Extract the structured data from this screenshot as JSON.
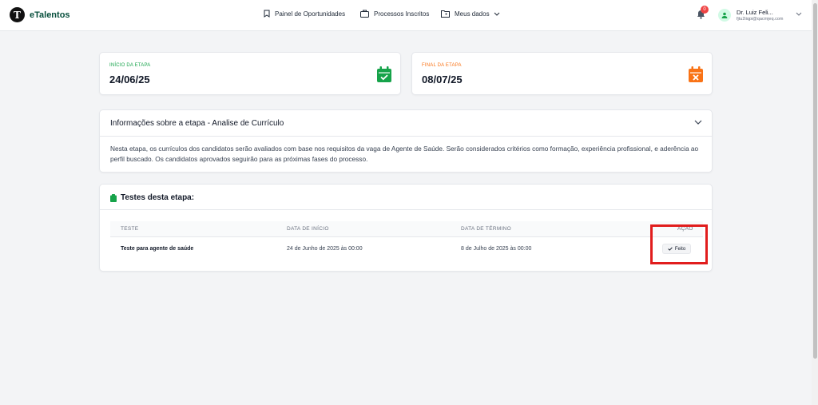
{
  "app": {
    "name": "eTalentos",
    "logo_letter": "T"
  },
  "nav": {
    "opportunities": "Painel de Oportunidades",
    "processes": "Processos Inscritos",
    "my_data": "Meus dados"
  },
  "notifications": {
    "count": "0"
  },
  "user": {
    "name": "Dr. Luiz Feli...",
    "email": "fjtu2iiqpi@qacmjeq.com"
  },
  "stage_start": {
    "label": "INÍCIO DA ETAPA",
    "date": "24/06/25"
  },
  "stage_end": {
    "label": "FINAL DA ETAPA",
    "date": "08/07/25"
  },
  "info": {
    "title": "Informações sobre a etapa - Analise de Currículo",
    "text": "Nesta etapa, os currículos dos candidatos serão avaliados com base nos requisitos da vaga de Agente de Saúde. Serão considerados critérios como formação, experiência profissional, e aderência ao perfil buscado. Os candidatos aprovados seguirão para as próximas fases do processo."
  },
  "tests": {
    "title": "Testes desta etapa:",
    "columns": [
      "TESTE",
      "DATA DE INÍCIO",
      "DATA DE TÉRMINO",
      "AÇÃO"
    ],
    "rows": [
      {
        "name": "Teste para agente de saúde",
        "start": "24 de Junho de 2025 às 00:00",
        "end": "8 de Julho de 2025 às 00:00",
        "action": "Feito"
      }
    ]
  },
  "colors": {
    "green": "#16a34a",
    "orange": "#f97316",
    "brand": "#064e3b",
    "highlight": "#e11d1d",
    "badge": "#ef4444"
  }
}
